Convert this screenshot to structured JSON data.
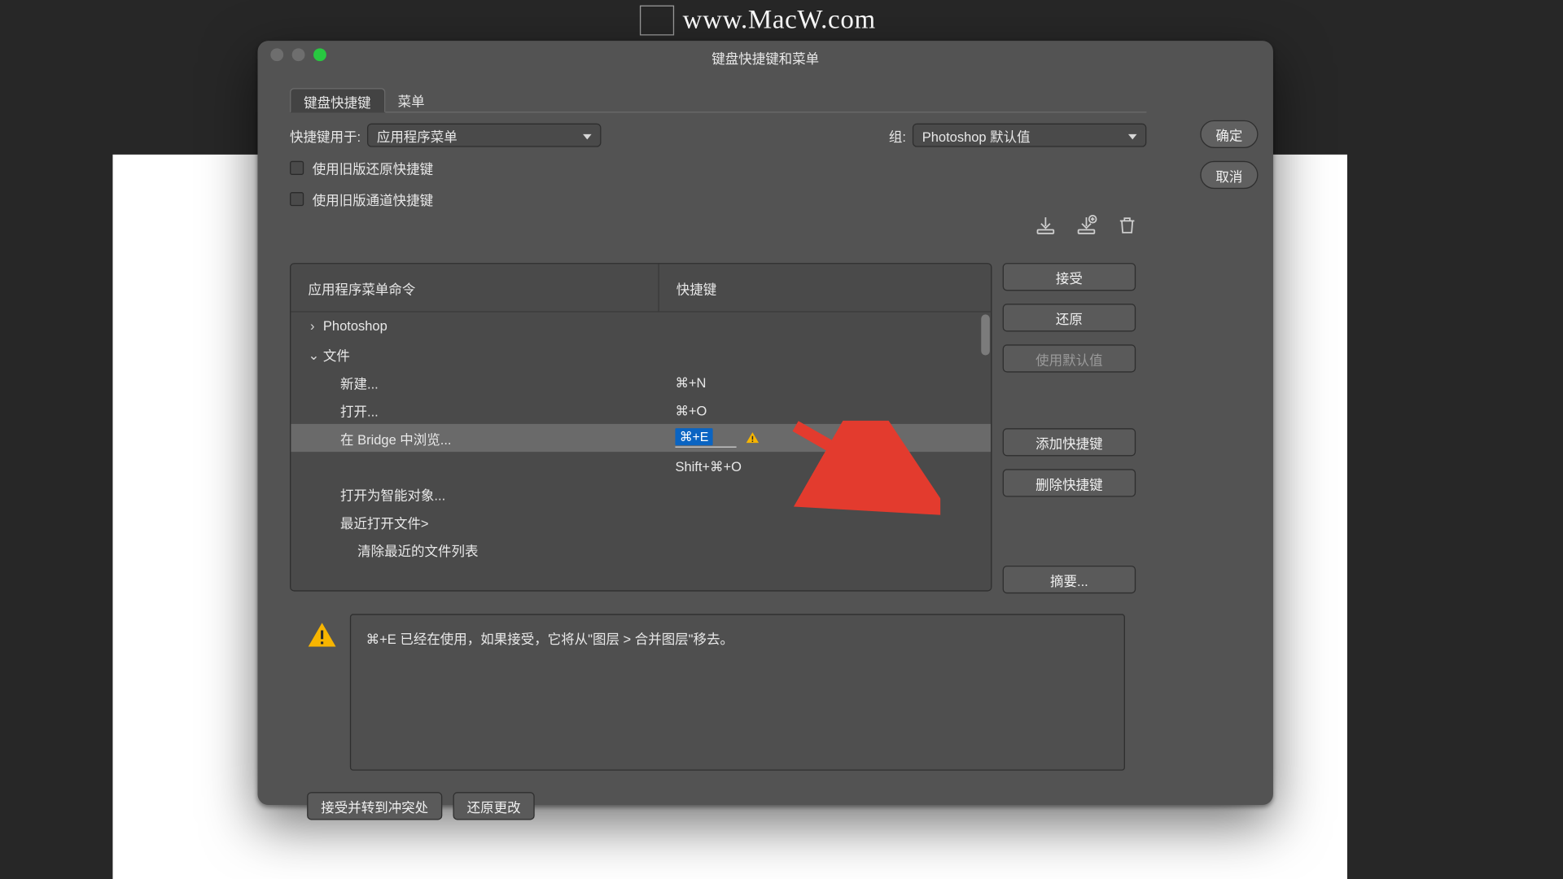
{
  "watermark": "www.MacW.com",
  "dialog_title": "键盘快捷键和菜单",
  "tabs": {
    "shortcuts": "键盘快捷键",
    "menus": "菜单"
  },
  "shortcuts_for": {
    "label": "快捷键用于:",
    "value": "应用程序菜单"
  },
  "set": {
    "label": "组:",
    "value": "Photoshop 默认值"
  },
  "check_legacy_undo": "使用旧版还原快捷键",
  "check_legacy_channel": "使用旧版通道快捷键",
  "columns": {
    "cmd": "应用程序菜单命令",
    "key": "快捷键"
  },
  "buttons": {
    "ok": "确定",
    "cancel": "取消",
    "accept": "接受",
    "revert": "还原",
    "defaults": "使用默认值",
    "add": "添加快捷键",
    "delete": "删除快捷键",
    "summary": "摘要...",
    "accept_go": "接受并转到冲突处",
    "undo_changes": "还原更改"
  },
  "tree": {
    "photoshop": "Photoshop",
    "file": "文件",
    "items": [
      {
        "label": "新建...",
        "key": "⌘+N"
      },
      {
        "label": "打开...",
        "key": "⌘+O"
      },
      {
        "label": "在 Bridge 中浏览...",
        "key_edit": "⌘+E",
        "secondary": "Shift+⌘+O"
      },
      {
        "label": "打开为智能对象...",
        "key": ""
      },
      {
        "label": "最近打开文件>",
        "key": ""
      },
      {
        "label": "清除最近的文件列表",
        "key": "",
        "deep": true
      }
    ]
  },
  "message": "⌘+E 已经在使用，如果接受，它将从\"图层 > 合并图层\"移去。"
}
